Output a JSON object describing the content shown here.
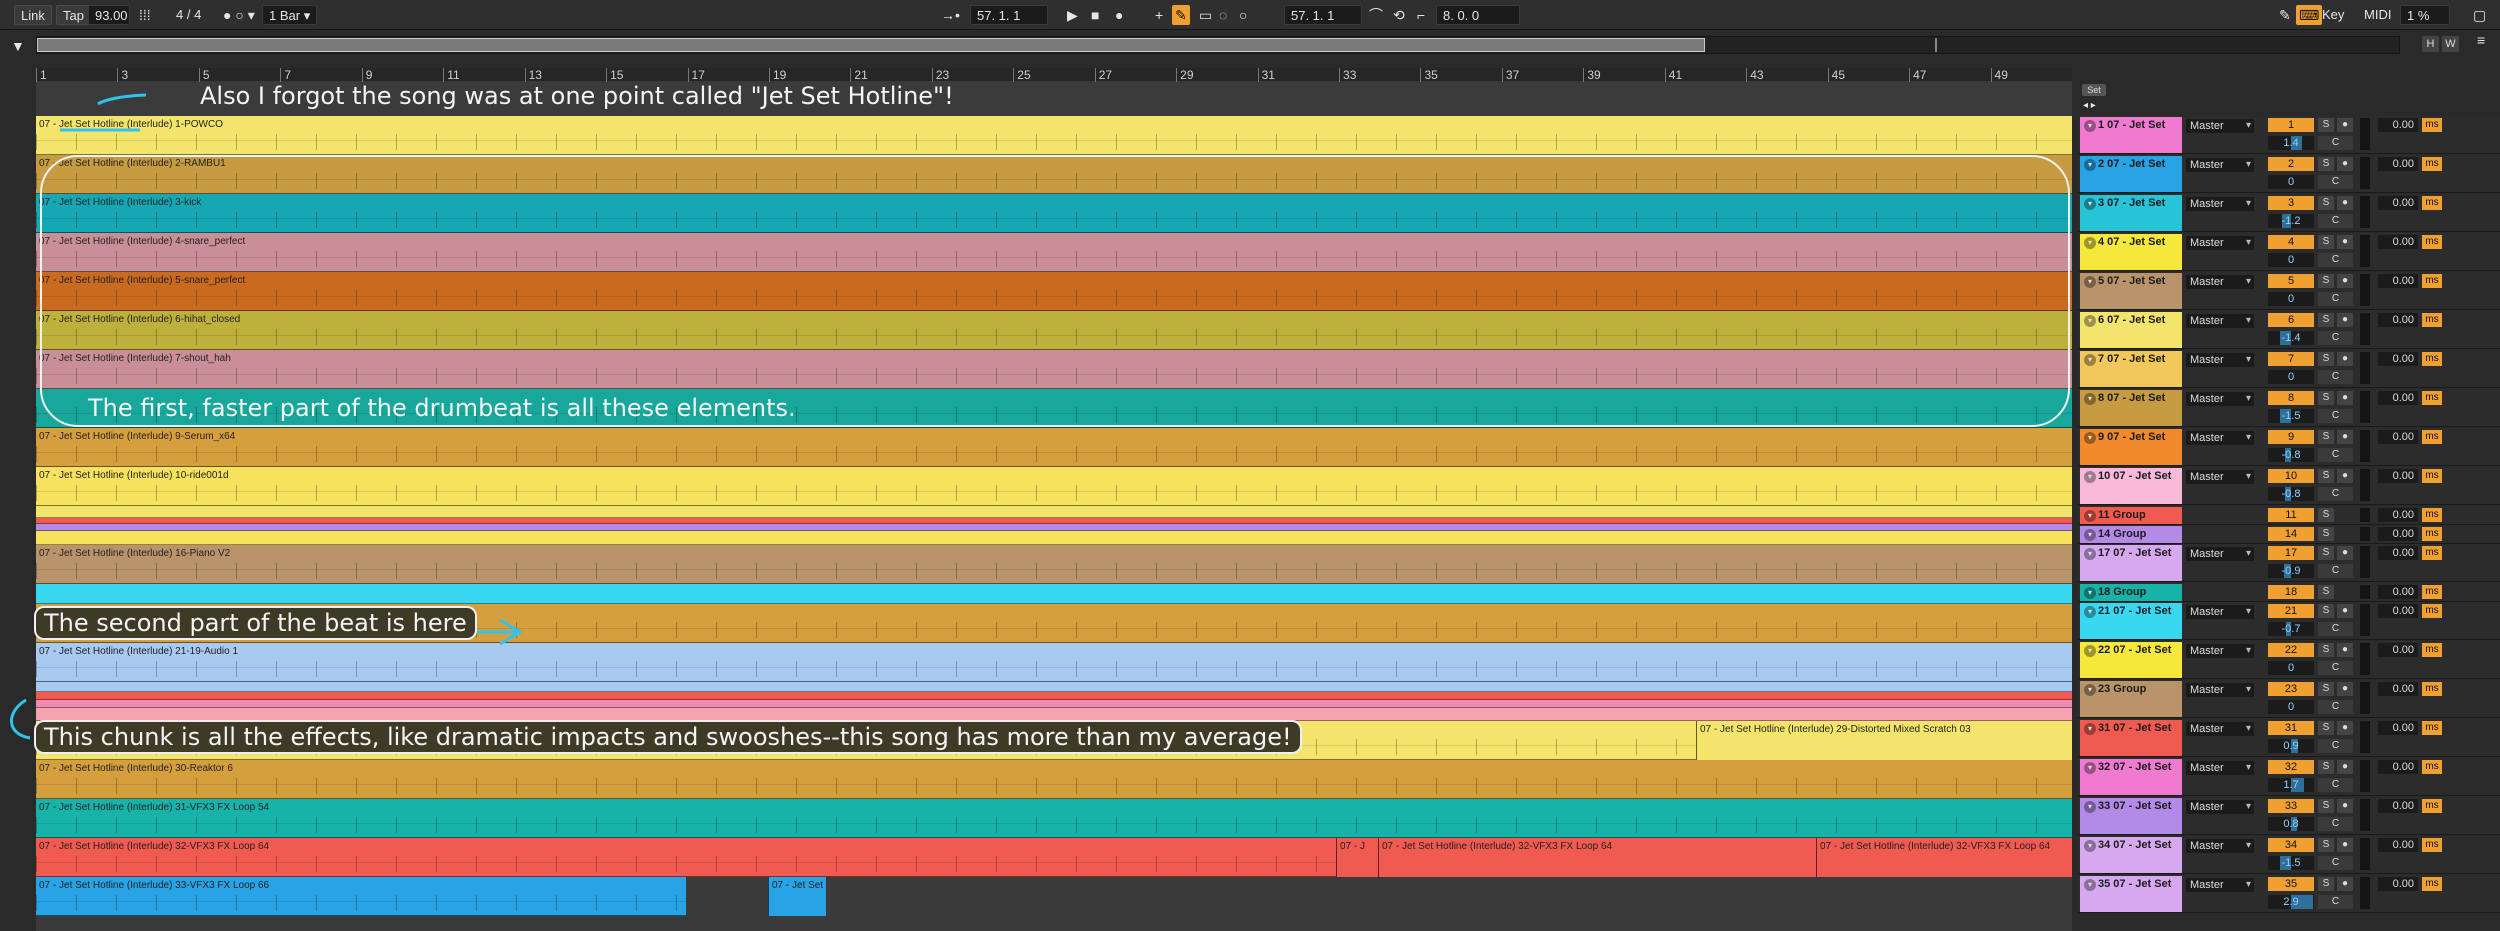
{
  "toolbar": {
    "link": "Link",
    "tap": "Tap",
    "tempo": "93.00",
    "signature": "4 / 4",
    "quantize": "1 Bar",
    "position": "57.  1.  1",
    "loop_start": "57.  1.  1",
    "loop_length": "8.  0.  0",
    "key": "Key",
    "midi": "MIDI",
    "cpu": "1 %"
  },
  "overview": {
    "h_label": "H",
    "w_label": "W"
  },
  "ruler": {
    "bars": [
      "1",
      "3",
      "5",
      "7",
      "9",
      "11",
      "13",
      "15",
      "17",
      "19",
      "21",
      "23",
      "25",
      "27",
      "29",
      "31",
      "33",
      "35",
      "37",
      "39",
      "41",
      "43",
      "45",
      "47",
      "49"
    ]
  },
  "set_label": "Set",
  "colors": {
    "accent": "#f0a030",
    "annotation_frame": "#f2f2f2"
  },
  "lanes": [
    {
      "clip": "07 - Jet Set Hotline (Interlude) 1-POWCO",
      "color": "#f3e46b"
    },
    {
      "clip": "07 - Jet Set Hotline (Interlude) 2-RAMBU1",
      "color": "#c79b42"
    },
    {
      "clip": "07 - Jet Set Hotline (Interlude) 3-kick",
      "color": "#16a7b5"
    },
    {
      "clip": "07 - Jet Set Hotline (Interlude) 4-snare_perfect",
      "color": "#c98e97"
    },
    {
      "clip": "07 - Jet Set Hotline (Interlude) 5-snare_perfect",
      "color": "#c96a1f"
    },
    {
      "clip": "07 - Jet Set Hotline (Interlude) 6-hihat_closed",
      "color": "#bdb13c"
    },
    {
      "clip": "07 - Jet Set Hotline (Interlude) 7-shout_hah",
      "color": "#c98e97"
    },
    {
      "clip": "",
      "color": "#18a79b"
    },
    {
      "clip": "07 - Jet Set Hotline (Interlude) 9-Serum_x64",
      "color": "#d69f3e"
    },
    {
      "clip": "07 - Jet Set Hotline (Interlude) 10-ride001d",
      "color": "#f6e25c"
    },
    {
      "clip": "07 - Jet Set Hotline (Interlude) 16-Piano V2",
      "color": "#b9946a"
    },
    {
      "clip": "",
      "color": "#d69f3e"
    },
    {
      "clip": "07 - Jet Set Hotline (Interlude) 21-19-Audio 1",
      "color": "#a8c9f0"
    },
    {
      "clip": "",
      "color": "#f3e46b"
    },
    {
      "clip": "07 - Jet Set Hotline (Interlude) 30-Reaktor 6",
      "color": "#d69f3e"
    },
    {
      "clip": "07 - Jet Set Hotline (Interlude) 31-VFX3 FX Loop 54",
      "color": "#17b2a8"
    },
    {
      "clip": "07 - Jet Set Hotline (Interlude) 32-VFX3 FX Loop 64",
      "color": "#f05a50"
    },
    {
      "clip": "07 - Jet Set Hotline (Interlude) 33-VFX3 FX Loop 66",
      "color": "#27a3e6"
    }
  ],
  "extra_clips": [
    {
      "label": "07 - Jet Set Hotline (Interlude) 29-Distorted Mixed Scratch 03"
    },
    {
      "label": "07 - J"
    },
    {
      "label": "07 - Jet Set Hotline (Interlude) 32-VFX3 FX Loop 64"
    },
    {
      "label": "07 - Jet Set Hotline (Interlude) 32-VFX3 FX Loop 64"
    },
    {
      "label": "07 - Jet Set"
    }
  ],
  "mixer": [
    {
      "name": "1 07 - Jet Set",
      "color": "#f07ad0",
      "route": "Master",
      "num": "1",
      "pan": "1.4",
      "vol": "0.00"
    },
    {
      "name": "2 07 - Jet Set",
      "color": "#27a3e6",
      "route": "Master",
      "num": "2",
      "pan": "0",
      "vol": "0.00"
    },
    {
      "name": "3 07 - Jet Set",
      "color": "#27c4d8",
      "route": "Master",
      "num": "3",
      "pan": "-1.2",
      "vol": "0.00"
    },
    {
      "name": "4 07 - Jet Set",
      "color": "#f5e83a",
      "route": "Master",
      "num": "4",
      "pan": "0",
      "vol": "0.00"
    },
    {
      "name": "5 07 - Jet Set",
      "color": "#b9946a",
      "route": "Master",
      "num": "5",
      "pan": "0",
      "vol": "0.00"
    },
    {
      "name": "6 07 - Jet Set",
      "color": "#f3e46b",
      "route": "Master",
      "num": "6",
      "pan": "-1.4",
      "vol": "0.00"
    },
    {
      "name": "7 07 - Jet Set",
      "color": "#f3c85a",
      "route": "Master",
      "num": "7",
      "pan": "0",
      "vol": "0.00"
    },
    {
      "name": "8 07 - Jet Set",
      "color": "#c79b42",
      "route": "Master",
      "num": "8",
      "pan": "-1.5",
      "vol": "0.00"
    },
    {
      "name": "9 07 - Jet Set",
      "color": "#f08a2c",
      "route": "Master",
      "num": "9",
      "pan": "-0.8",
      "vol": "0.00"
    },
    {
      "name": "10 07 - Jet Set",
      "color": "#f8b8d8",
      "route": "Master",
      "num": "10",
      "pan": "-0.8",
      "vol": "0.00"
    },
    {
      "name": "11 Group",
      "color": "#f05a50",
      "route": "",
      "num": "11",
      "pan": "",
      "vol": "0.00",
      "small": true
    },
    {
      "name": "14 Group",
      "color": "#b48ae8",
      "route": "",
      "num": "14",
      "pan": "",
      "vol": "0.00",
      "small": true
    },
    {
      "name": "17 07 - Jet Set",
      "color": "#d6a8f0",
      "route": "Master",
      "num": "17",
      "pan": "-0.9",
      "vol": "0.00"
    },
    {
      "name": "18 Group",
      "color": "#17b2a8",
      "route": "",
      "num": "18",
      "pan": "",
      "vol": "0.00",
      "small": true
    },
    {
      "name": "21 07 - Jet Set",
      "color": "#3ad8f0",
      "route": "Master",
      "num": "21",
      "pan": "-0.7",
      "vol": "0.00"
    },
    {
      "name": "22 07 - Jet Set",
      "color": "#f5e83a",
      "route": "Master",
      "num": "22",
      "pan": "0",
      "vol": "0.00"
    },
    {
      "name": "23 Group",
      "color": "#b9946a",
      "route": "Master",
      "num": "23",
      "pan": "0",
      "vol": "0.00"
    },
    {
      "name": "31 07 - Jet Set",
      "color": "#f05a50",
      "route": "Master",
      "num": "31",
      "pan": "0.9",
      "vol": "0.00"
    },
    {
      "name": "32 07 - Jet Set",
      "color": "#f07ad0",
      "route": "Master",
      "num": "32",
      "pan": "1.7",
      "vol": "0.00"
    },
    {
      "name": "33 07 - Jet Set",
      "color": "#b48ae8",
      "route": "Master",
      "num": "33",
      "pan": "0.8",
      "vol": "0.00"
    },
    {
      "name": "34 07 - Jet Set",
      "color": "#d6a8f0",
      "route": "Master",
      "num": "34",
      "pan": "-1.5",
      "vol": "0.00"
    },
    {
      "name": "35 07 - Jet Set",
      "color": "#d6a8f0",
      "route": "Master",
      "num": "35",
      "pan": "2.9",
      "vol": "0.00"
    }
  ],
  "annotations": {
    "note1": "Also I forgot the song was at one point called \"Jet Set Hotline\"!",
    "note2": "The first, faster part of the drumbeat is all these elements.",
    "note3": "The second part of the beat is here",
    "note4": "This chunk is all the effects, like dramatic impacts and swooshes--this song has more than my average!"
  }
}
